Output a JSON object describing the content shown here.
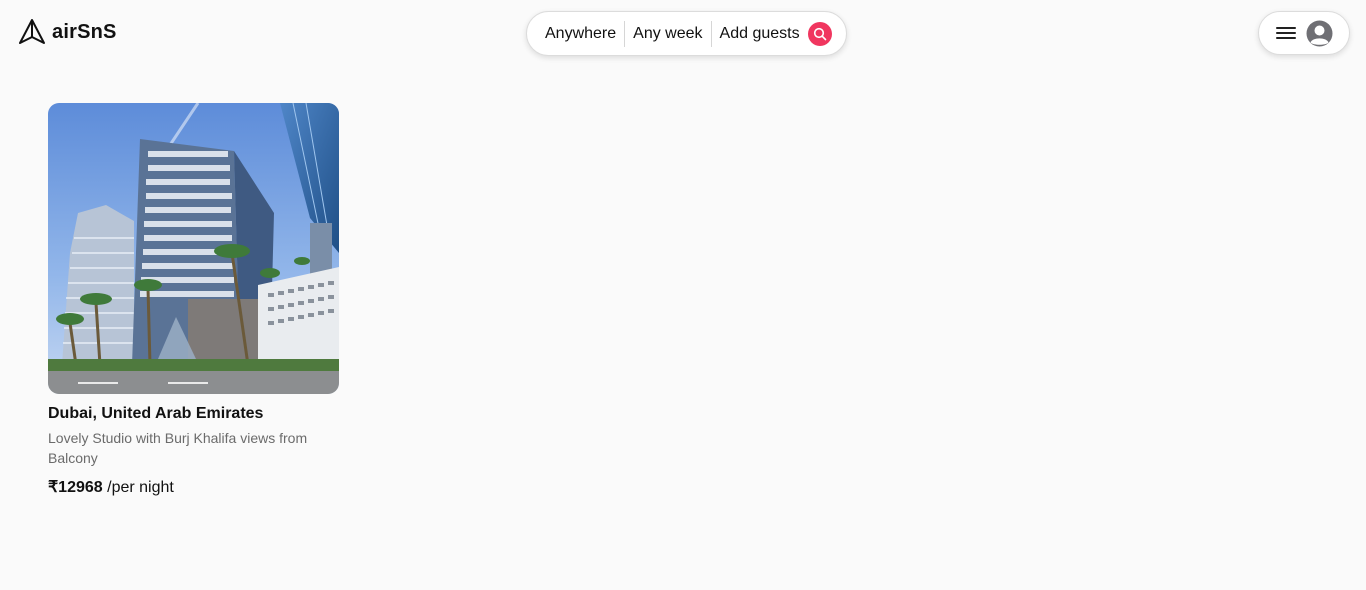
{
  "header": {
    "brand": "airSnS",
    "search": {
      "where": "Anywhere",
      "when": "Any week",
      "who": "Add guests"
    }
  },
  "listings": [
    {
      "location": "Dubai, United Arab Emirates",
      "description": "Lovely Studio with Burj Khalifa views from Balcony",
      "price": "₹12968",
      "price_unit": "/per night"
    }
  ],
  "colors": {
    "accent": "#f0365f",
    "page_background": "#fafafa"
  }
}
